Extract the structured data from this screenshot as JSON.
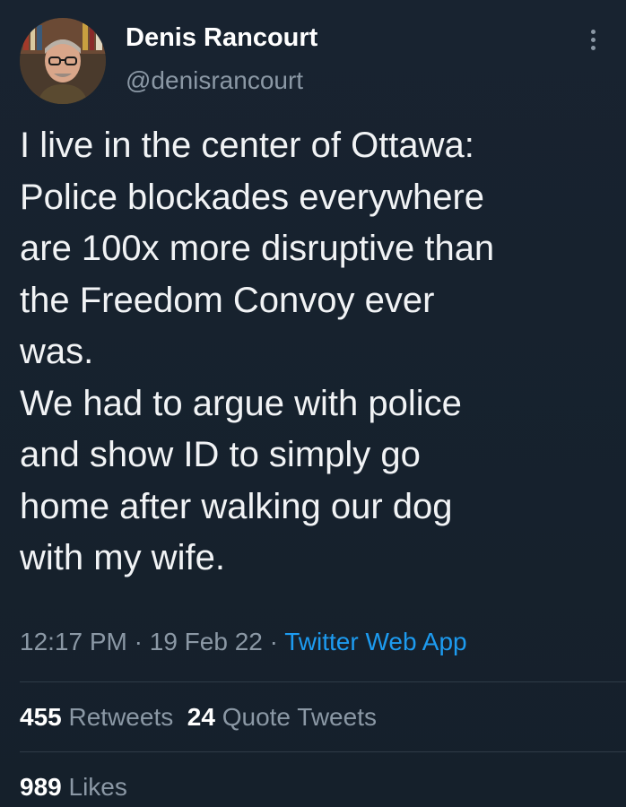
{
  "author": {
    "name": "Denis Rancourt",
    "handle": "@denisrancourt"
  },
  "more_icon": "more-vertical-icon",
  "tweet": {
    "lines": [
      "I live in the center of Ottawa:",
      "Police blockades everywhere",
      "are 100x more disruptive than",
      "the Freedom Convoy ever",
      "was.",
      "We had to argue with police",
      "and show ID to simply go",
      "home after walking our dog",
      "with my wife."
    ]
  },
  "meta": {
    "time": "12:17 PM",
    "separator": " · ",
    "date": "19 Feb 22",
    "source": "Twitter Web App"
  },
  "stats": {
    "retweets_count": "455",
    "retweets_label": "Retweets",
    "quotes_count": "24",
    "quotes_label": "Quote Tweets",
    "likes_count": "989",
    "likes_label": "Likes"
  },
  "colors": {
    "background": "#15202b",
    "text": "#ffffff",
    "secondary": "#8b98a5",
    "link": "#1d9bf0"
  }
}
